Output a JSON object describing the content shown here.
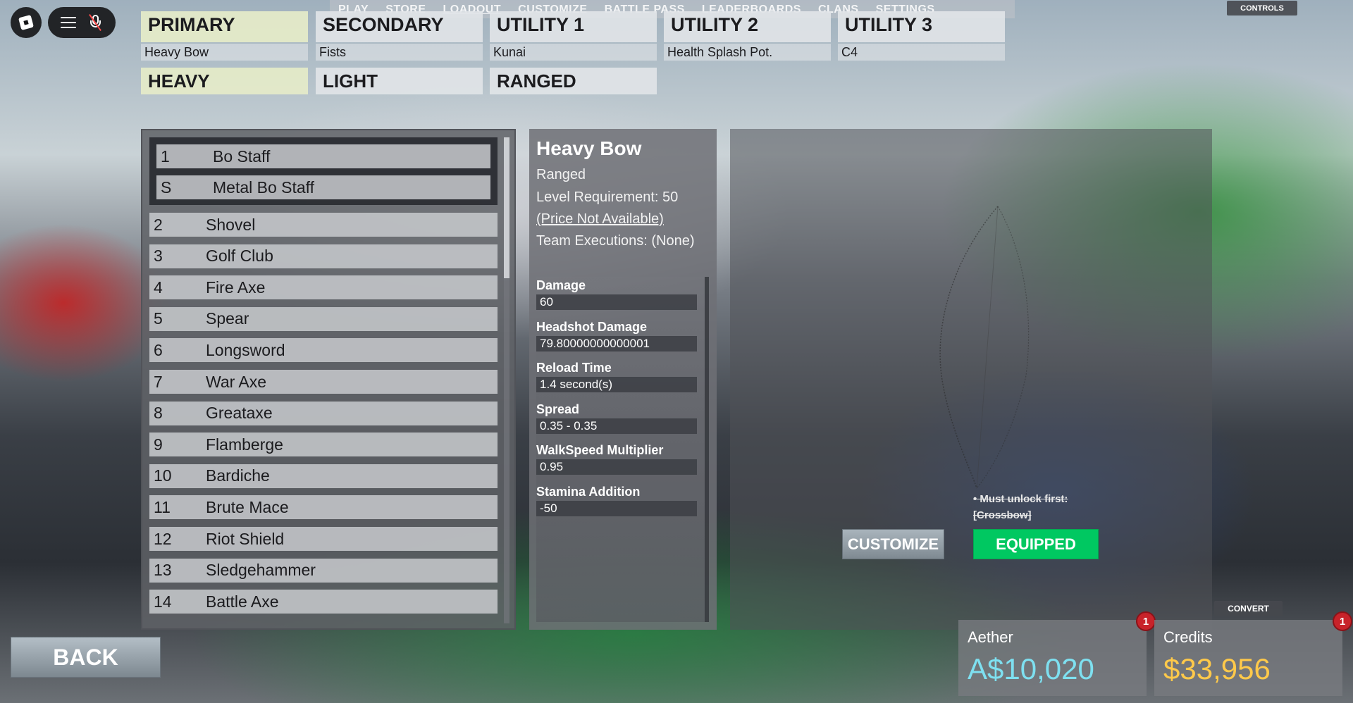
{
  "top_nav": {
    "items": [
      "PLAY",
      "STORE",
      "LOADOUT",
      "CUSTOMIZE",
      "BATTLE PASS",
      "LEADERBOARDS",
      "CLANS",
      "SETTINGS"
    ],
    "controls_label": "CONTROLS"
  },
  "slots": [
    {
      "title": "PRIMARY",
      "item": "Heavy Bow"
    },
    {
      "title": "SECONDARY",
      "item": "Fists"
    },
    {
      "title": "UTILITY 1",
      "item": "Kunai"
    },
    {
      "title": "UTILITY 2",
      "item": "Health Splash Pot."
    },
    {
      "title": "UTILITY 3",
      "item": "C4"
    }
  ],
  "categories": [
    "HEAVY",
    "LIGHT",
    "RANGED"
  ],
  "weapon_group": [
    {
      "num": "1",
      "name": "Bo Staff"
    },
    {
      "num": "S",
      "name": "Metal Bo Staff"
    }
  ],
  "weapons": [
    {
      "num": "2",
      "name": "Shovel"
    },
    {
      "num": "3",
      "name": "Golf Club"
    },
    {
      "num": "4",
      "name": "Fire Axe"
    },
    {
      "num": "5",
      "name": "Spear"
    },
    {
      "num": "6",
      "name": "Longsword"
    },
    {
      "num": "7",
      "name": "War Axe"
    },
    {
      "num": "8",
      "name": "Greataxe"
    },
    {
      "num": "9",
      "name": "Flamberge"
    },
    {
      "num": "10",
      "name": "Bardiche"
    },
    {
      "num": "11",
      "name": "Brute Mace"
    },
    {
      "num": "12",
      "name": "Riot Shield"
    },
    {
      "num": "13",
      "name": "Sledgehammer"
    },
    {
      "num": "14",
      "name": "Battle Axe"
    }
  ],
  "info": {
    "title": "Heavy Bow",
    "type": "Ranged",
    "level_requirement": "Level Requirement: 50",
    "price": "(Price Not Available)",
    "team_executions": "Team Executions: (None)",
    "stats": [
      {
        "label": "Damage",
        "value": "60"
      },
      {
        "label": "Headshot Damage",
        "value": "79.80000000000001"
      },
      {
        "label": "Reload Time",
        "value": "1.4 second(s)"
      },
      {
        "label": "Spread",
        "value": "0.35 - 0.35"
      },
      {
        "label": "WalkSpeed Multiplier",
        "value": "0.95"
      },
      {
        "label": "Stamina Addition",
        "value": "-50"
      }
    ]
  },
  "preview": {
    "unlock_note": "• Must unlock first: [Crossbow]",
    "customize_label": "CUSTOMIZE",
    "equipped_label": "EQUIPPED"
  },
  "back_label": "BACK",
  "convert_label": "CONVERT",
  "currencies": [
    {
      "label": "Aether",
      "value": "A$10,020",
      "badge": "1",
      "color": "#7ee0f0"
    },
    {
      "label": "Credits",
      "value": "$33,956",
      "badge": "1",
      "color": "#ffc94a"
    }
  ],
  "colors": {
    "equipped_green": "#00c861",
    "active_slot": "#e4eac8",
    "badge_red": "#c8232a"
  }
}
